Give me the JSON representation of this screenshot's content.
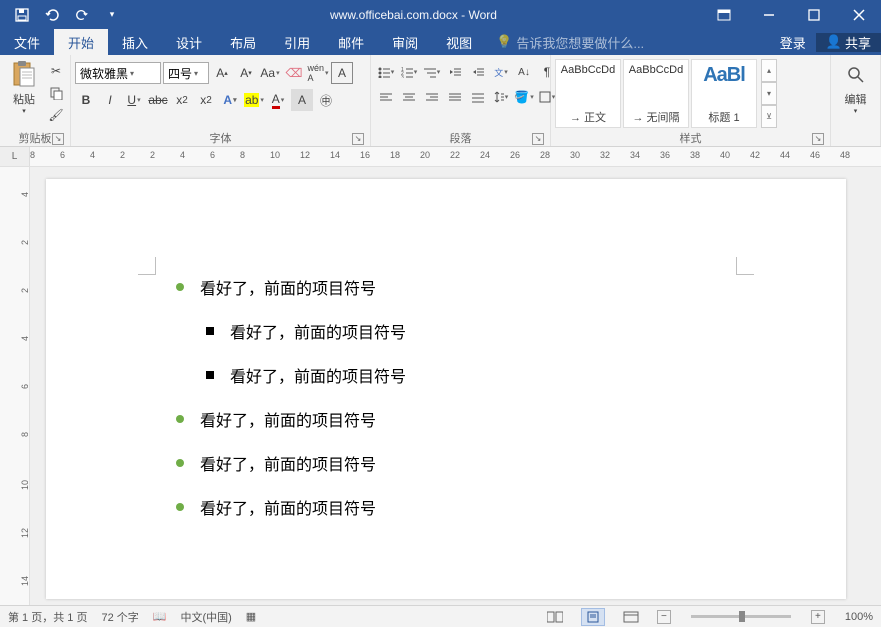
{
  "title": "www.officebai.com.docx - Word",
  "tabs": {
    "file": "文件",
    "home": "开始",
    "insert": "插入",
    "design": "设计",
    "layout": "布局",
    "references": "引用",
    "mailings": "邮件",
    "review": "审阅",
    "view": "视图",
    "tellme_placeholder": "告诉我您想要做什么...",
    "signin": "登录",
    "share": "共享"
  },
  "ribbon": {
    "clipboard": {
      "label": "剪贴板",
      "paste": "粘贴"
    },
    "font": {
      "label": "字体",
      "family": "微软雅黑",
      "size": "四号"
    },
    "paragraph": {
      "label": "段落"
    },
    "styles": {
      "label": "样式",
      "items": [
        {
          "preview": "AaBbCcDd",
          "name": "→ 正文",
          "big": false
        },
        {
          "preview": "AaBbCcDd",
          "name": "→ 无间隔",
          "big": false
        },
        {
          "preview": "AaBl",
          "name": "标题 1",
          "big": true
        }
      ]
    },
    "editing": {
      "label": "编辑"
    }
  },
  "ruler_h": [
    "8",
    "6",
    "4",
    "2",
    "2",
    "4",
    "6",
    "8",
    "10",
    "12",
    "14",
    "16",
    "18",
    "20",
    "22",
    "24",
    "26",
    "28",
    "30",
    "32",
    "34",
    "36",
    "38",
    "40",
    "42",
    "44",
    "46",
    "48"
  ],
  "ruler_v": [
    "4",
    "2",
    "2",
    "4",
    "6",
    "8",
    "10",
    "12",
    "14"
  ],
  "document": {
    "lines": [
      {
        "level": 1,
        "bullet": "green",
        "text": "看好了，前面的项目符号"
      },
      {
        "level": 2,
        "bullet": "square",
        "text": "看好了，前面的项目符号"
      },
      {
        "level": 2,
        "bullet": "square",
        "text": "看好了，前面的项目符号"
      },
      {
        "level": 1,
        "bullet": "green",
        "text": "看好了，前面的项目符号"
      },
      {
        "level": 1,
        "bullet": "green",
        "text": "看好了，前面的项目符号"
      },
      {
        "level": 1,
        "bullet": "green",
        "text": "看好了，前面的项目符号"
      }
    ]
  },
  "status": {
    "page": "第 1 页，共 1 页",
    "words": "72 个字",
    "language": "中文(中国)",
    "zoom": "100%"
  }
}
